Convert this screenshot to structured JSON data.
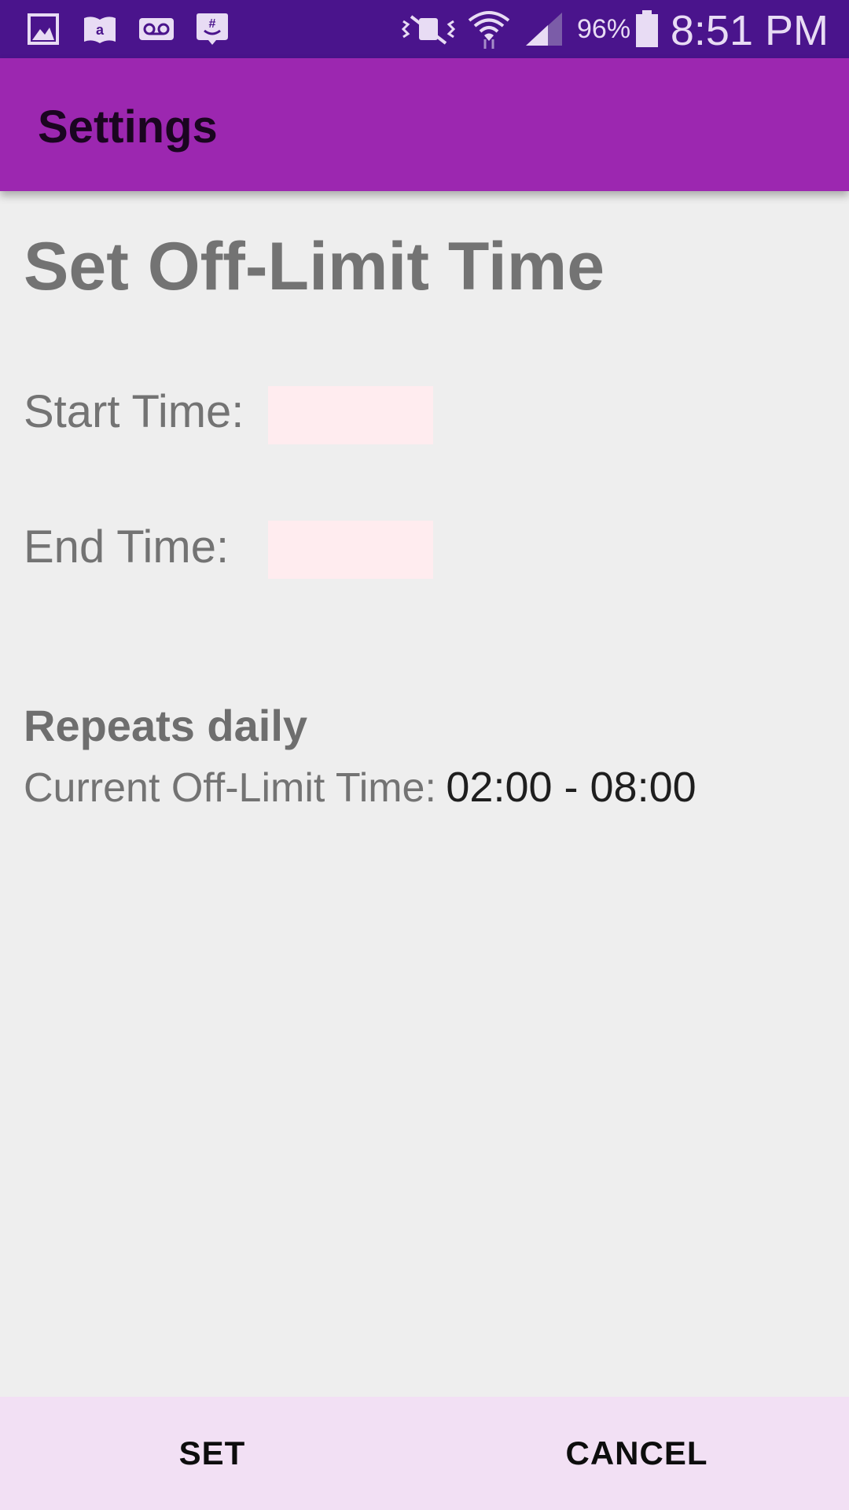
{
  "status_bar": {
    "icons_left": [
      "gallery-icon",
      "amazon-kindle-icon",
      "voicemail-icon",
      "groupme-icon"
    ],
    "icons_right": [
      "vibrate-mute-icon",
      "wifi-icon",
      "signal-icon",
      "battery-icon"
    ],
    "battery_percent": "96%",
    "time": "8:51 PM",
    "color": "#4a148c"
  },
  "app_bar": {
    "title": "Settings",
    "color": "#9c27b0"
  },
  "main": {
    "heading": "Set Off-Limit Time",
    "start_time": {
      "label": "Start Time:",
      "value": "",
      "placeholder": ""
    },
    "end_time": {
      "label": "End Time:",
      "value": "",
      "placeholder": ""
    },
    "repeats_text": "Repeats daily",
    "current_label": "Current Off-Limit Time:",
    "current_value": "02:00 - 08:00"
  },
  "bottom_bar": {
    "set_label": "SET",
    "cancel_label": "CANCEL",
    "color": "#f2e0f4"
  }
}
